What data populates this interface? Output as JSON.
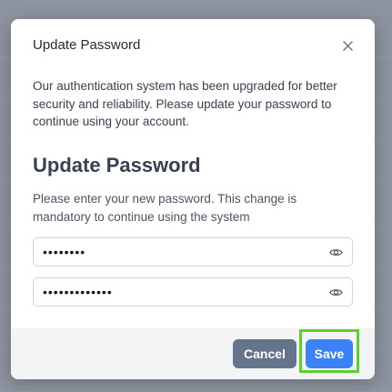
{
  "modal": {
    "title": "Update Password",
    "intro": "Our authentication system has been upgraded for better security and reliability. Please update your password to continue using your account.",
    "section_title": "Update Password",
    "section_description": "Please enter your new password. This change is mandatory to continue using the system",
    "close_icon": "close-icon"
  },
  "fields": [
    {
      "value": "••••••••",
      "icon": "eye-icon"
    },
    {
      "value": "•••••••••••••",
      "icon": "eye-icon"
    }
  ],
  "footer": {
    "cancel_label": "Cancel",
    "save_label": "Save"
  },
  "colors": {
    "primary": "#3b82f6",
    "secondary": "#64748b",
    "highlight": "#5ad22a"
  }
}
